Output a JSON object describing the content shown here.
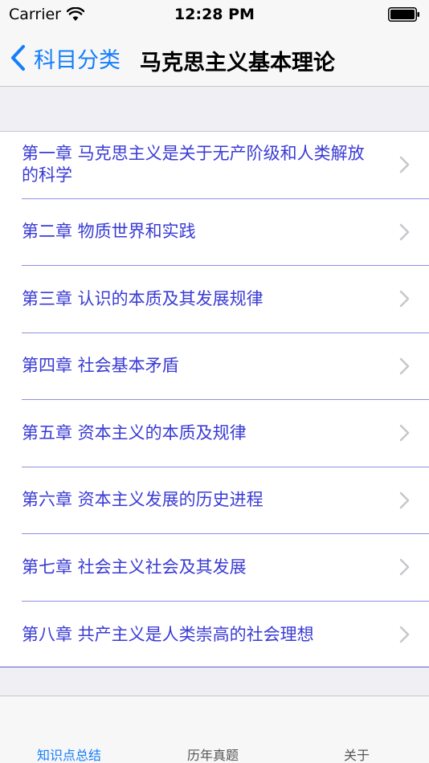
{
  "status_bar": {
    "carrier": "Carrier",
    "time": "12:28 PM"
  },
  "nav": {
    "back_label": "科目分类",
    "title": "马克思主义基本理论"
  },
  "chapters": [
    "第一章 马克思主义是关于无产阶级和人类解放的科学",
    "第二章 物质世界和实践",
    "第三章 认识的本质及其发展规律",
    "第四章 社会基本矛盾",
    "第五章 资本主义的本质及规律",
    "第六章 资本主义发展的历史进程",
    "第七章 社会主义社会及其发展",
    "第八章 共产主义是人类崇高的社会理想"
  ],
  "tabs": {
    "knowledge": "知识点总结",
    "exams": "历年真题",
    "about": "关于"
  },
  "colors": {
    "accent": "#147efb",
    "chapter_text": "#3a3bd4"
  }
}
